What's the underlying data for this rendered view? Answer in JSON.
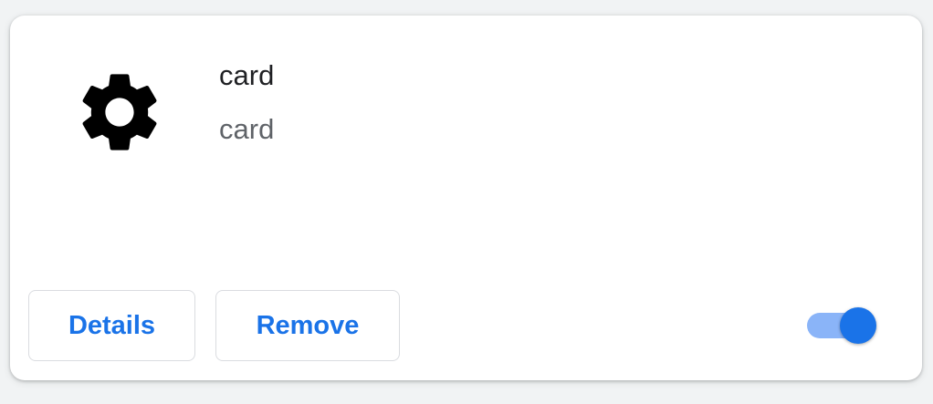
{
  "extension": {
    "name": "card",
    "description": "card",
    "icon": "gear-icon",
    "enabled": true
  },
  "actions": {
    "details_label": "Details",
    "remove_label": "Remove"
  },
  "colors": {
    "accent": "#1a73e8",
    "toggle_track": "#8ab4f8",
    "title_text": "#202124",
    "secondary_text": "#5f6368",
    "button_border": "#dadce0"
  }
}
